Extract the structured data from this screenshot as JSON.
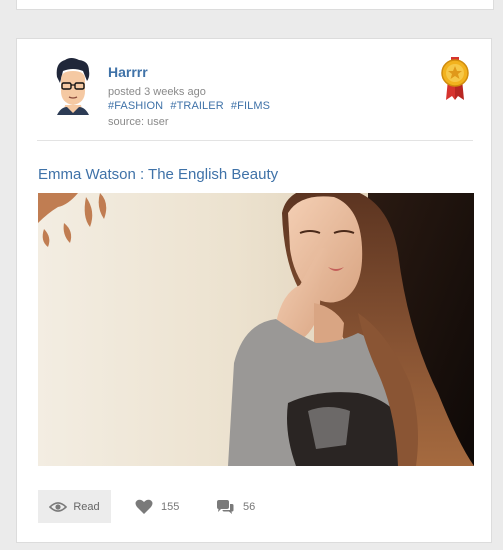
{
  "post": {
    "author": "Harrrr",
    "posted": "posted 3 weeks ago",
    "tags": [
      "#FASHION",
      "#TRAILER",
      "#FILMS"
    ],
    "source": "source: user",
    "title": "Emma Watson : The English Beauty",
    "image_subject": "Emma Watson portrait"
  },
  "actions": {
    "read_label": "Read",
    "likes": "155",
    "comments": "56"
  },
  "icons": {
    "avatar": "cartoon-avatar",
    "badge": "gold-medal-badge",
    "read": "eye-icon",
    "likes": "heart-icon",
    "comments": "comment-bubbles-icon"
  },
  "colors": {
    "link": "#3f72a8",
    "muted": "#8a8a8a",
    "background": "#ebebeb",
    "badge_gold": "#f2b21e",
    "badge_ribbon": "#d6332e"
  }
}
